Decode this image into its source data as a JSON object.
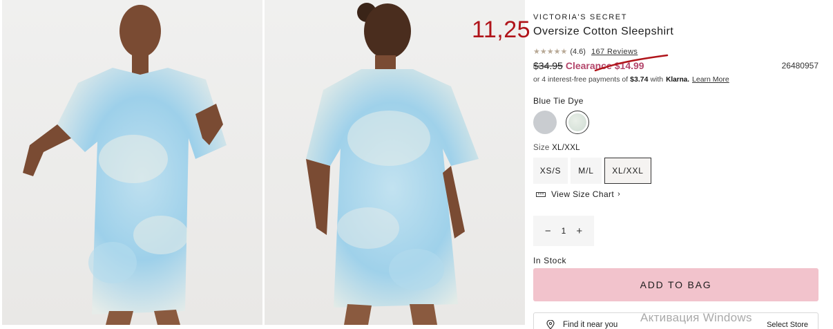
{
  "annotation": {
    "handwritten_price": "11,25"
  },
  "product": {
    "brand": "VICTORIA'S SECRET",
    "title": "Oversize Cotton Sleepshirt",
    "stars": "★★★★★",
    "rating": "(4.6)",
    "reviews": "167 Reviews",
    "original_price": "$34.95",
    "clearance_label": "Clearance",
    "clearance_price": "$14.99",
    "sku": "26480957"
  },
  "klarna": {
    "prefix": "or 4 interest-free payments of",
    "amount": "$3.74",
    "with": "with",
    "logo": "Klarna.",
    "learn_more": "Learn More"
  },
  "color": {
    "selected": "Blue Tie Dye",
    "swatches": [
      "#c9ccd0",
      "#dde7de"
    ]
  },
  "size": {
    "label": "Size",
    "selected": "XL/XXL",
    "options": [
      "XS/S",
      "M/L",
      "XL/XXL"
    ],
    "chart_link": "View Size Chart",
    "chart_chevron": "›"
  },
  "quantity": {
    "minus": "−",
    "value": "1",
    "plus": "+"
  },
  "stock": "In Stock",
  "add_to_bag": "ADD TO BAG",
  "find_store": {
    "label": "Find it near you",
    "action": "Select Store"
  },
  "watermark": "Активация Windows",
  "colors": {
    "clearance": "#b3456a",
    "button": "#f2c3cc",
    "annotation": "#b0141a"
  }
}
